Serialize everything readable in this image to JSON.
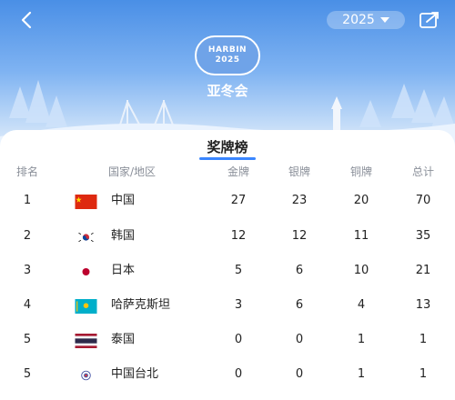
{
  "header": {
    "year": "2025",
    "logo_line1": "HARBIN",
    "logo_line2": "2025",
    "event_name": "亚冬会"
  },
  "card": {
    "title": "奖牌榜"
  },
  "columns": {
    "rank": "排名",
    "country": "国家/地区",
    "gold": "金牌",
    "silver": "银牌",
    "bronze": "铜牌",
    "total": "总计"
  },
  "rows": [
    {
      "rank": "1",
      "country": "中国",
      "gold": "27",
      "silver": "23",
      "bronze": "20",
      "total": "70",
      "flag_icon": "china-flag-icon"
    },
    {
      "rank": "2",
      "country": "韩国",
      "gold": "12",
      "silver": "12",
      "bronze": "11",
      "total": "35",
      "flag_icon": "korea-flag-icon"
    },
    {
      "rank": "3",
      "country": "日本",
      "gold": "5",
      "silver": "6",
      "bronze": "10",
      "total": "21",
      "flag_icon": "japan-flag-icon"
    },
    {
      "rank": "4",
      "country": "哈萨克斯坦",
      "gold": "3",
      "silver": "6",
      "bronze": "4",
      "total": "13",
      "flag_icon": "kazakhstan-flag-icon"
    },
    {
      "rank": "5",
      "country": "泰国",
      "gold": "0",
      "silver": "0",
      "bronze": "1",
      "total": "1",
      "flag_icon": "thailand-flag-icon"
    },
    {
      "rank": "5",
      "country": "中国台北",
      "gold": "0",
      "silver": "0",
      "bronze": "1",
      "total": "1",
      "flag_icon": "chinese-taipei-flag-icon"
    }
  ],
  "colors": {
    "accent": "#3a86ff",
    "sky_top": "#4a8fe6",
    "header_text": "#8a8f99"
  }
}
